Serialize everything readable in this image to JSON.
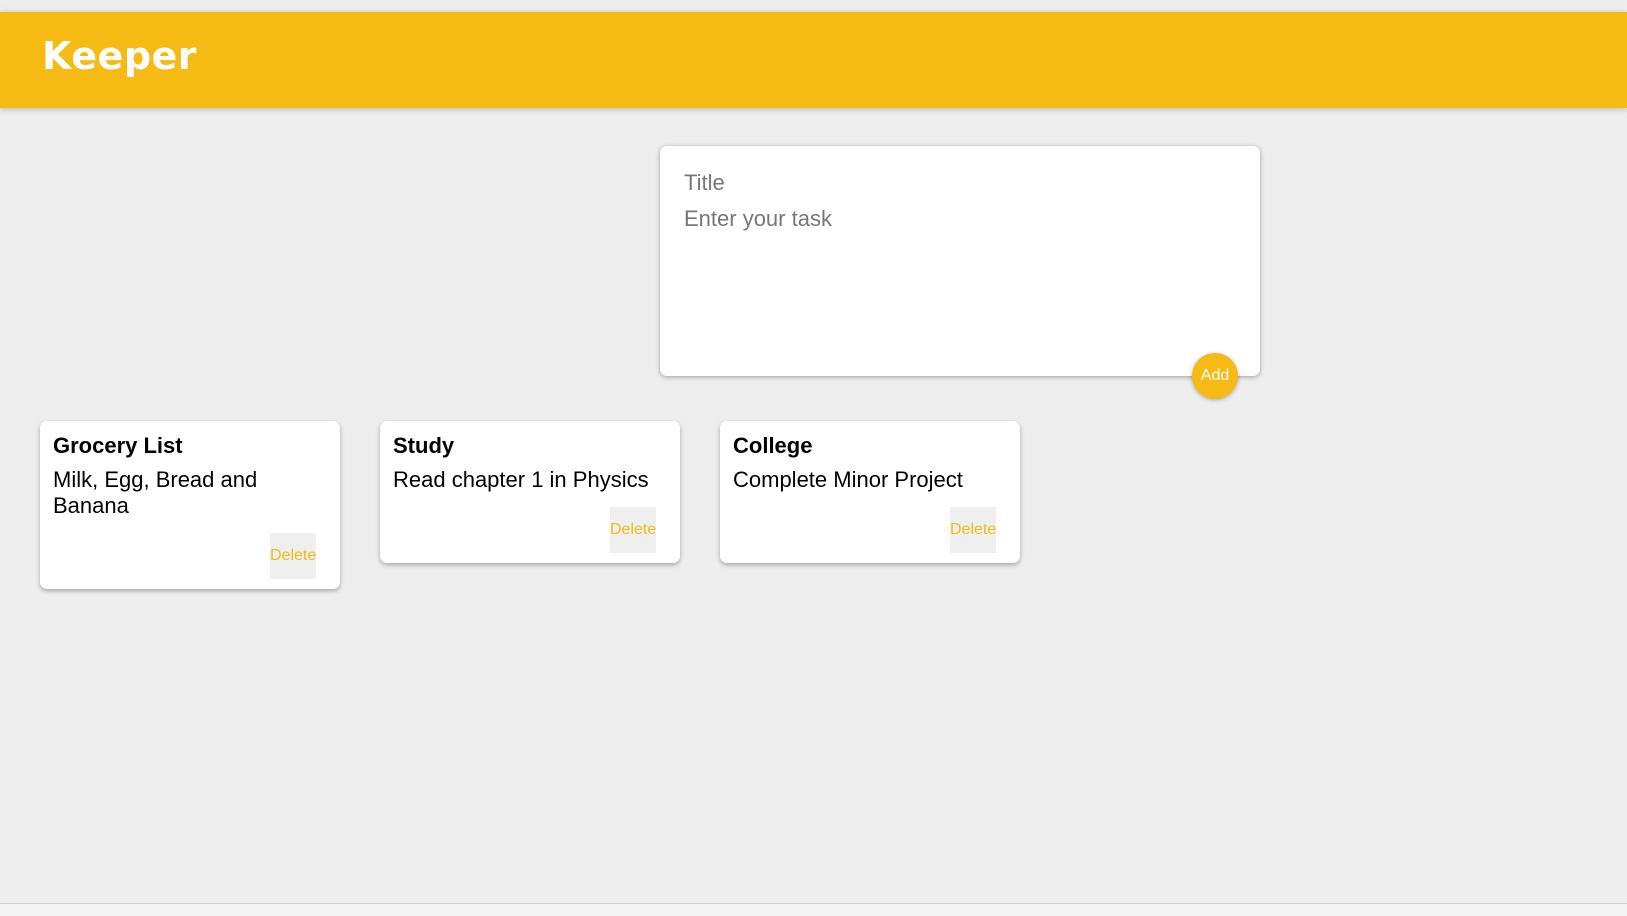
{
  "app": {
    "title": "Keeper"
  },
  "create_note": {
    "title_placeholder": "Title",
    "content_placeholder": "Enter your task",
    "add_label": "Add"
  },
  "notes": [
    {
      "title": "Grocery List",
      "content": "Milk, Egg, Bread and Banana",
      "delete_label": "Delete"
    },
    {
      "title": "Study",
      "content": "Read chapter 1 in Physics",
      "delete_label": "Delete"
    },
    {
      "title": "College",
      "content": "Complete Minor Project",
      "delete_label": "Delete"
    }
  ],
  "colors": {
    "accent": "#f5ba13",
    "background": "#eeeeee",
    "card": "#ffffff"
  }
}
